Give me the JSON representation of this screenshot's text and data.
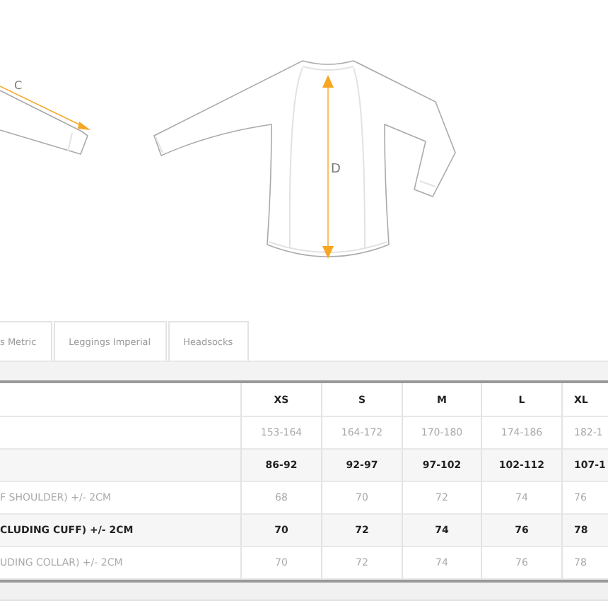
{
  "figures": [
    {
      "kind": "sleeve",
      "label": "C"
    },
    {
      "kind": "shirt",
      "label": "D"
    }
  ],
  "tabs": [
    {
      "label": "s Metric",
      "selected": false
    },
    {
      "label": "Leggings Imperial",
      "selected": false
    },
    {
      "label": "Headsocks",
      "selected": false
    }
  ],
  "table": {
    "columns": [
      "XS",
      "S",
      "M",
      "L",
      "XL"
    ],
    "rows": [
      {
        "emphasis": false,
        "cells": [
          "153-164",
          "164-172",
          "170-180",
          "174-186",
          "182-1"
        ]
      },
      {
        "emphasis": true,
        "cells": [
          "86-92",
          "92-97",
          "97-102",
          "102-112",
          "107-1"
        ]
      },
      {
        "emphasis": false,
        "label": "F SHOULDER) +/- 2CM",
        "cells": [
          "68",
          "70",
          "72",
          "74",
          "76"
        ]
      },
      {
        "emphasis": true,
        "label": "CLUDING CUFF) +/- 2CM",
        "cells": [
          "70",
          "72",
          "74",
          "76",
          "78"
        ]
      },
      {
        "emphasis": false,
        "label": "UDING COLLAR) +/- 2CM",
        "cells": [
          "70",
          "72",
          "74",
          "76",
          "78"
        ]
      }
    ]
  }
}
